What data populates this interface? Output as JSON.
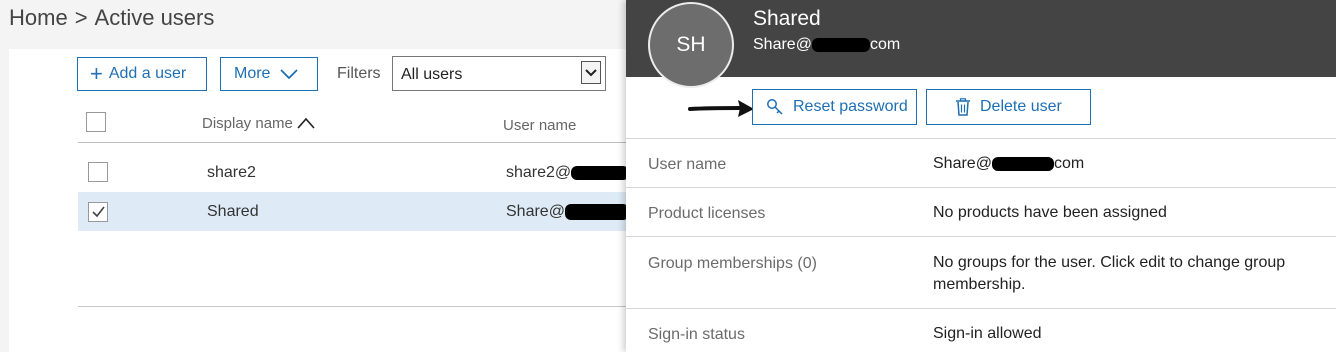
{
  "breadcrumb": {
    "home": "Home",
    "separator": ">",
    "current": "Active users"
  },
  "toolbar": {
    "add_user_icon": "plus-icon",
    "add_user_label": "Add a user",
    "more_label": "More",
    "filters_label": "Filters",
    "filter_value": "All users"
  },
  "table": {
    "columns": [
      "Display name",
      "User name"
    ],
    "sort_indicator": "caret-up-icon",
    "rows": [
      {
        "display_name": "share2",
        "user_name": "share2@",
        "checked": false
      },
      {
        "display_name": "Shared",
        "user_name": "Share@",
        "checked": true
      }
    ]
  },
  "flyout": {
    "avatar_initials": "SH",
    "name": "Shared",
    "email_prefix": "Share@",
    "email_suffix": "com",
    "actions": {
      "reset_password": "Reset password",
      "delete_user": "Delete user"
    },
    "properties": [
      {
        "label": "User name",
        "value_prefix": "Share@",
        "value_suffix": "com"
      },
      {
        "label": "Product licenses",
        "value": "No products have been assigned"
      },
      {
        "label": "Group memberships (0)",
        "value": "No groups for the user. Click edit to change group membership."
      },
      {
        "label": "Sign-in status",
        "value": "Sign-in allowed"
      }
    ]
  },
  "colors": {
    "accent": "#1e6fb3",
    "header_bg": "#444444",
    "selected_row": "#deebf6"
  }
}
